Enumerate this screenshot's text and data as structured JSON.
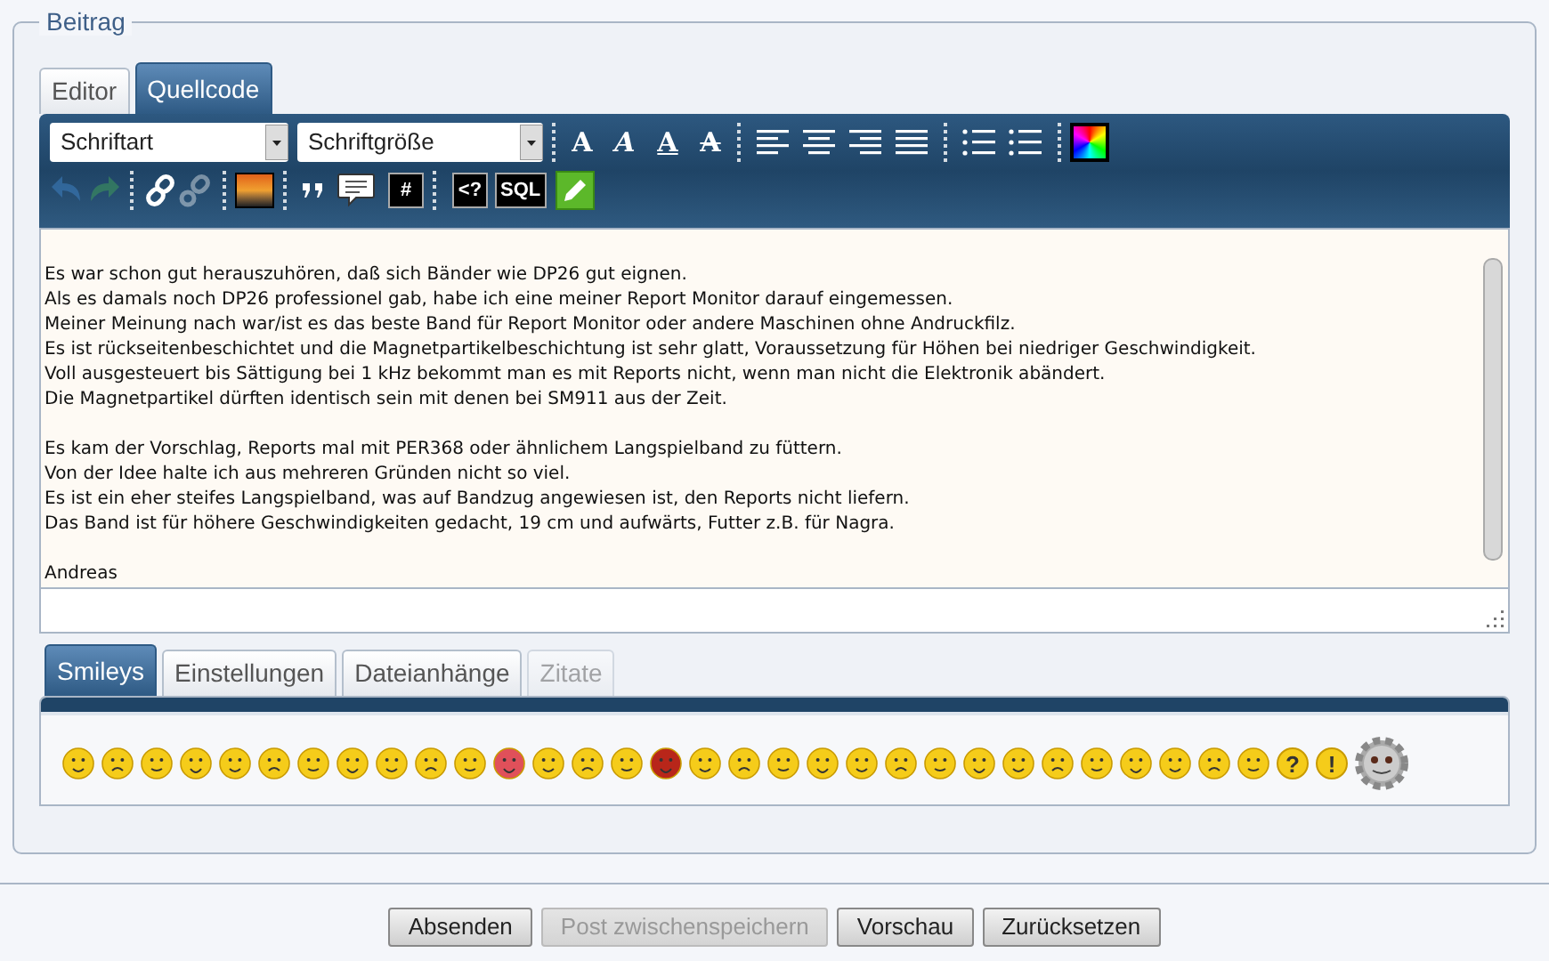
{
  "fieldset": {
    "legend": "Beitrag"
  },
  "editor_tabs": [
    {
      "label": "Editor",
      "selected": false
    },
    {
      "label": "Quellcode",
      "selected": true
    }
  ],
  "toolbar": {
    "font_select": "Schriftart",
    "size_select": "Schriftgröße",
    "format_buttons": [
      {
        "kind": "bold",
        "glyph": "A"
      },
      {
        "kind": "italic",
        "glyph": "A"
      },
      {
        "kind": "underline",
        "glyph": "A"
      },
      {
        "kind": "strike",
        "glyph": "A"
      }
    ],
    "history_buttons": [
      {
        "kind": "undo",
        "disabled": true
      },
      {
        "kind": "redo",
        "disabled": true
      }
    ],
    "link_buttons": [
      {
        "kind": "link",
        "disabled": false
      },
      {
        "kind": "unlink",
        "disabled": true
      }
    ],
    "code_buttons": [
      {
        "glyph": "#"
      },
      {
        "glyph": "<?"
      },
      {
        "glyph": "SQL"
      }
    ]
  },
  "paragraphs": [
    [
      "Es war schon gut herauszuhören, daß sich Bänder wie DP26 gut eignen.",
      "Als es damals noch DP26 professionel gab, habe ich eine meiner Report Monitor darauf eingemessen.",
      "Meiner Meinung nach war/ist es das beste Band für Report Monitor oder andere Maschinen ohne Andruckfilz.",
      "Es ist rückseitenbeschichtet und die Magnetpartikelbeschichtung ist sehr glatt, Voraussetzung für Höhen bei niedriger Geschwindigkeit.",
      "Voll ausgesteuert bis Sättigung bei 1 kHz bekommt man es mit Reports nicht, wenn man nicht die Elektronik abändert.",
      "Die Magnetpartikel dürften identisch sein mit denen bei SM911 aus der Zeit."
    ],
    [
      "Es kam der Vorschlag, Reports mal mit PER368 oder ähnlichem Langspielband zu füttern.",
      "Von der Idee halte ich aus mehreren Gründen nicht so viel.",
      "Es ist ein eher steifes Langspielband, was auf Bandzug angewiesen ist, den Reports nicht liefern.",
      "Das Band ist für höhere Geschwindigkeiten gedacht, 19 cm und aufwärts, Futter z.B. für Nagra."
    ],
    [
      "Andreas"
    ]
  ],
  "lower_tabs": [
    {
      "label": "Smileys",
      "selected": true,
      "disabled": false
    },
    {
      "label": "Einstellungen",
      "selected": false,
      "disabled": false
    },
    {
      "label": "Dateianhänge",
      "selected": false,
      "disabled": false
    },
    {
      "label": "Zitate",
      "selected": false,
      "disabled": true
    }
  ],
  "smiley_signs": [
    "?",
    "!"
  ],
  "buttons": [
    {
      "label": "Absenden",
      "disabled": false
    },
    {
      "label": "Post zwischenspeichern",
      "disabled": true
    },
    {
      "label": "Vorschau",
      "disabled": false
    },
    {
      "label": "Zurücksetzen",
      "disabled": false
    }
  ]
}
